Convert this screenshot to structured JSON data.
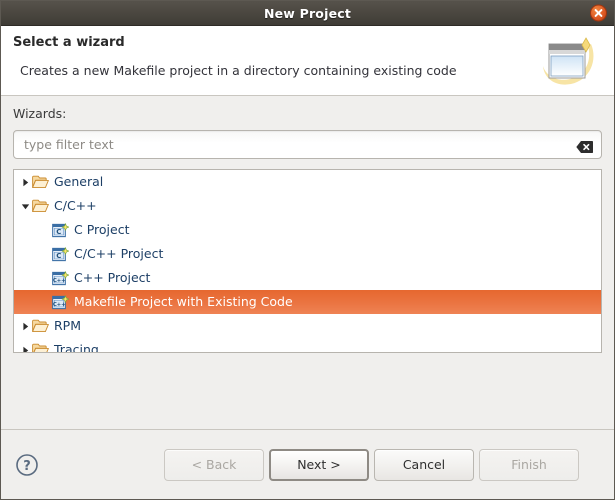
{
  "window": {
    "title": "New Project",
    "close_icon": "close-icon"
  },
  "header": {
    "title": "Select a wizard",
    "description": "Creates a new Makefile project in a directory containing existing code",
    "icon": "new-project-wizard-icon"
  },
  "main": {
    "wizards_label": "Wizards:",
    "filter": {
      "placeholder": "type filter text",
      "value": "",
      "clear_icon": "clear-filter-icon"
    },
    "tree": [
      {
        "label": "General",
        "level": 0,
        "expanded": false,
        "icon": "folder-icon",
        "selected": false
      },
      {
        "label": "C/C++",
        "level": 0,
        "expanded": true,
        "icon": "folder-icon",
        "selected": false
      },
      {
        "label": "C Project",
        "level": 1,
        "expanded": null,
        "icon": "c-project-icon",
        "selected": false
      },
      {
        "label": "C/C++ Project",
        "level": 1,
        "expanded": null,
        "icon": "c-project-icon",
        "selected": false
      },
      {
        "label": "C++ Project",
        "level": 1,
        "expanded": null,
        "icon": "cpp-project-icon",
        "selected": false
      },
      {
        "label": "Makefile Project with Existing Code",
        "level": 1,
        "expanded": null,
        "icon": "cpp-project-icon",
        "selected": true
      },
      {
        "label": "RPM",
        "level": 0,
        "expanded": false,
        "icon": "folder-icon",
        "selected": false
      },
      {
        "label": "Tracing",
        "level": 0,
        "expanded": false,
        "icon": "folder-icon",
        "selected": false
      }
    ]
  },
  "footer": {
    "help_icon": "help-icon",
    "buttons": [
      {
        "label": "< Back",
        "state": "disabled"
      },
      {
        "label": "Next >",
        "state": "default"
      },
      {
        "label": "Cancel",
        "state": "normal"
      },
      {
        "label": "Finish",
        "state": "disabled"
      }
    ]
  },
  "colors": {
    "titlebar": "#4b4740",
    "selection": "#e6672f",
    "close_button": "#de5b26",
    "link_text": "#1d3f66",
    "dialog_background": "#f0efed"
  }
}
